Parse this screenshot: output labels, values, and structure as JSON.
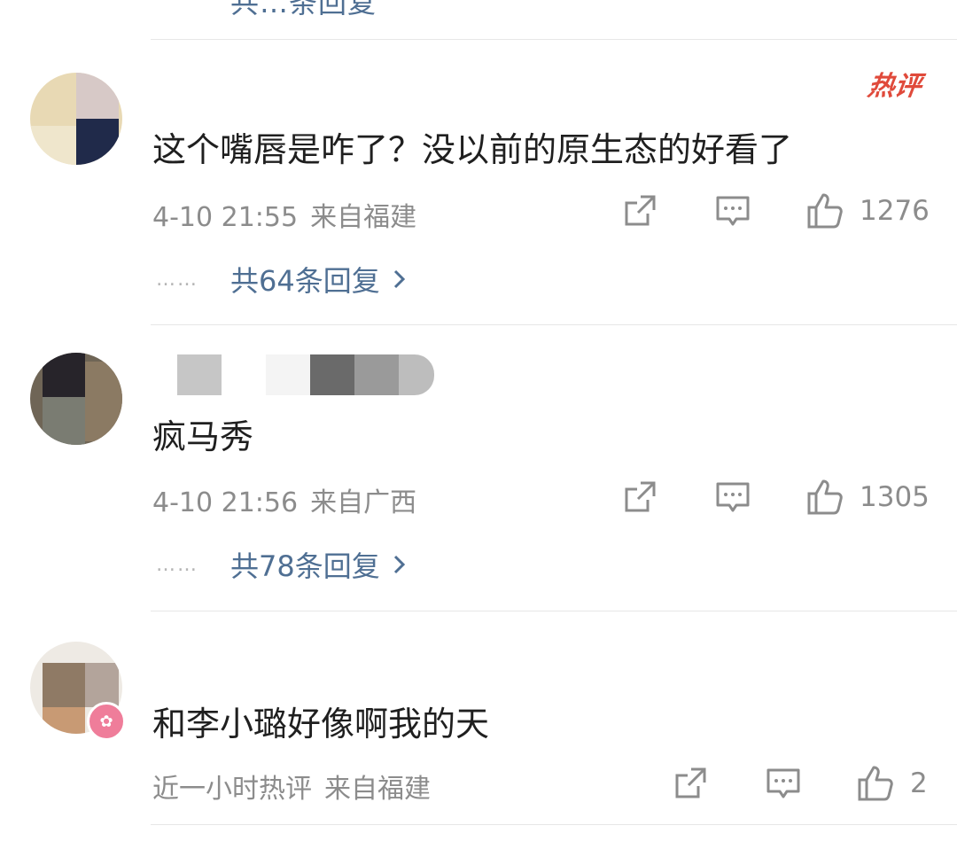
{
  "top_partial_text": "共…条回复",
  "comments": [
    {
      "hot_badge": "热评",
      "text": "这个嘴唇是咋了？没以前的原生态的好看了",
      "time": "4-10 21:55",
      "location": "来自福建",
      "likes": "1276",
      "replies_label": "共64条回复",
      "replies_dots": "……"
    },
    {
      "text": "疯马秀",
      "time": "4-10 21:56",
      "location": "来自广西",
      "likes": "1305",
      "replies_label": "共78条回复",
      "replies_dots": "……"
    },
    {
      "text": "和李小璐好像啊我的天",
      "time": "近一小时热评",
      "location": "来自福建",
      "likes": "2"
    }
  ],
  "icons": {
    "share": "share-icon",
    "comment": "comment-icon",
    "like": "thumbs-up-icon",
    "chevron": "chevron-right-icon",
    "vip": "vip-badge-icon"
  },
  "colors": {
    "link_blue": "#4f6f93",
    "meta_gray": "#8c8c8c",
    "hot_red": "#e04a3b"
  }
}
